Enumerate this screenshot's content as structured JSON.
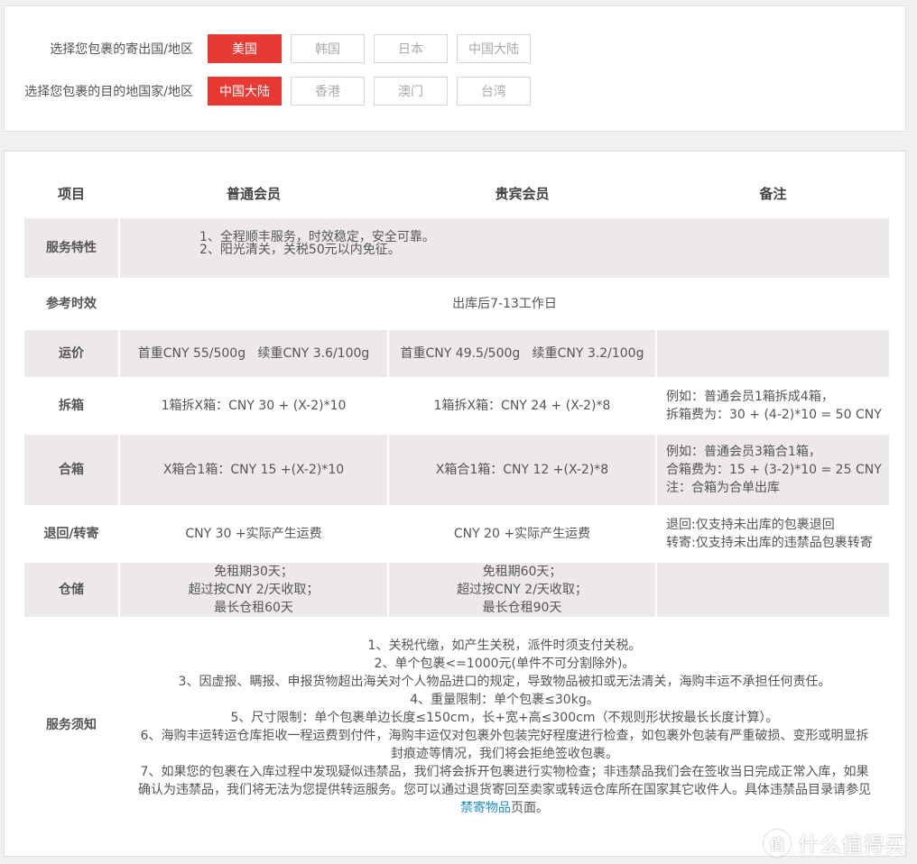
{
  "origin": {
    "label": "选择您包裹的寄出国/地区",
    "options": [
      "美国",
      "韩国",
      "日本",
      "中国大陆"
    ],
    "selected": "美国"
  },
  "destination": {
    "label": "选择您包裹的目的地国家/地区",
    "options": [
      "中国大陆",
      "香港",
      "澳门",
      "台湾"
    ],
    "selected": "中国大陆"
  },
  "table": {
    "headers": [
      "项目",
      "普通会员",
      "贵宾会员",
      "备注"
    ],
    "service_features": {
      "item": "服务特性",
      "lines": [
        "1、全程顺丰服务，时效稳定，安全可靠。",
        "2、阳光清关，关税50元以内免征。"
      ]
    },
    "delivery_time": {
      "item": "参考时效",
      "value": "出库后7-13工作日"
    },
    "freight": {
      "item": "运价",
      "regular": "首重CNY 55/500g   续重CNY 3.6/100g",
      "vip": "首重CNY 49.5/500g   续重CNY 3.2/100g",
      "note": ""
    },
    "split": {
      "item": "拆箱",
      "regular": "1箱拆X箱：CNY 30 + (X-2)*10",
      "vip": "1箱拆X箱：CNY 24 + (X-2)*8",
      "note_lines": [
        "例如：普通会员1箱拆成4箱，",
        "拆箱费为：30 + (4-2)*10 = 50 CNY"
      ]
    },
    "merge": {
      "item": "合箱",
      "regular": "X箱合1箱：CNY 15 +(X-2)*10",
      "vip": "X箱合1箱：CNY 12 +(X-2)*8",
      "note_lines": [
        "例如：普通会员3箱合1箱，",
        "合箱费为：15 + (3-2)*10 = 25 CNY",
        "注：合箱为合单出库"
      ]
    },
    "return": {
      "item": "退回/转寄",
      "regular": "CNY 30 +实际产生运费",
      "vip": "CNY 20 +实际产生运费",
      "note_lines": [
        "退回:仅支持未出库的包裹退回",
        "转寄:仅支持未出库的违禁品包裹转寄"
      ]
    },
    "storage": {
      "item": "仓储",
      "regular_lines": [
        "免租期30天；",
        "超过按CNY 2/天收取；",
        "最长仓租60天"
      ],
      "vip_lines": [
        "免租期60天；",
        "超过按CNY 2/天收取；",
        "最长仓租90天"
      ],
      "note": ""
    },
    "notice": {
      "item": "服务须知",
      "lines": [
        "1、关税代缴，如产生关税，派件时须支付关税。",
        "2、单个包裹<=1000元(单件不可分割除外)。",
        "3、因虚报、瞒报、申报货物超出海关对个人物品进口的规定，导致物品被扣或无法清关，海购丰运不承担任何责任。",
        "4、重量限制：单个包裹≤30kg。",
        "5、尺寸限制：单个包裹单边长度≤150cm，长+宽+高≤300cm（不规则形状按最长长度计算）。",
        "6、海购丰运转运仓库拒收一程运费到付件，海购丰运仅对包裹外包装完好程度进行检查，如包裹外包装有严重破损、变形或明显拆封痕迹等情况，我们将会拒绝签收包裹。",
        "7、如果您的包裹在入库过程中发现疑似违禁品，我们将会拆开包裹进行实物检查；非违禁品我们会在签收当日完成正常入库，如果确认为违禁品，我们将无法为您提供转运服务。您可以通过退货寄回至卖家或转运仓库所在国家其它收件人。具体违禁品目录请参见"
      ],
      "link_text": "禁寄物品",
      "link_suffix": "页面。"
    }
  },
  "watermark": {
    "logo": "值",
    "text": "什么值得买"
  }
}
